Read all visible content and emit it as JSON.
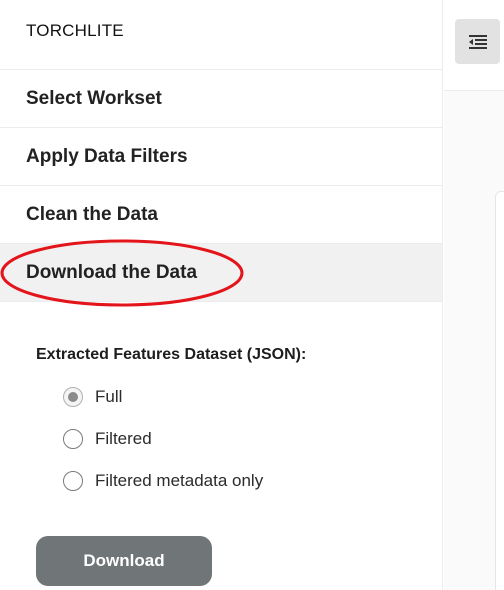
{
  "brand": {
    "title": "TORCHLITE"
  },
  "nav": {
    "items": [
      {
        "label": "Select Workset"
      },
      {
        "label": "Apply Data Filters"
      },
      {
        "label": "Clean the Data"
      },
      {
        "label": "Download the Data",
        "active": true
      }
    ]
  },
  "download_panel": {
    "title": "Extracted Features Dataset (JSON):",
    "options": [
      {
        "label": "Full",
        "selected": true
      },
      {
        "label": "Filtered",
        "selected": false
      },
      {
        "label": "Filtered metadata only",
        "selected": false
      }
    ],
    "button_label": "Download"
  },
  "topbar": {
    "toggle_icon": "menu-collapse-icon"
  },
  "colors": {
    "button_bg": "#707677",
    "active_bg": "#f1f1f1",
    "annotation": "#e3151b"
  }
}
